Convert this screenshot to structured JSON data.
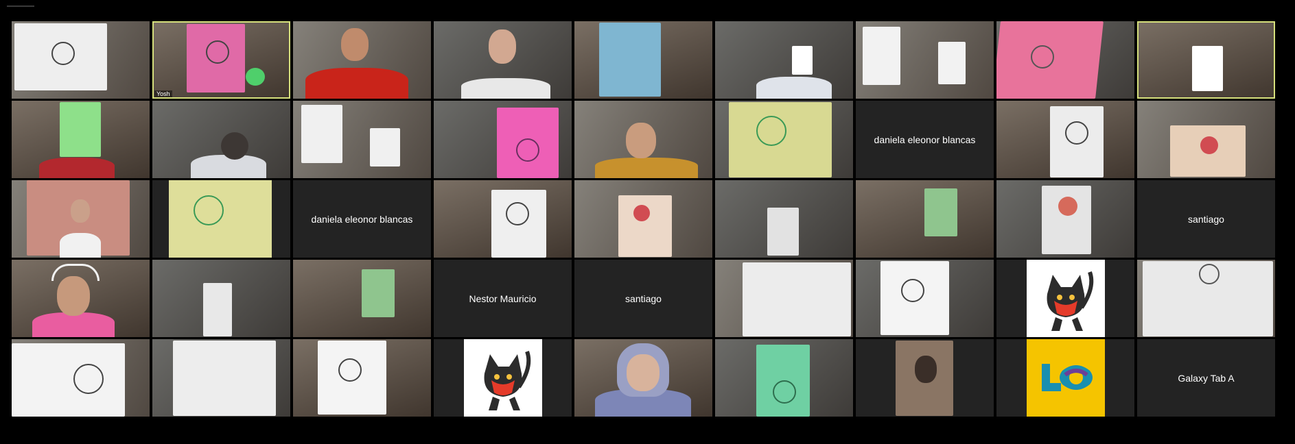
{
  "meeting": {
    "tiles": [
      {
        "label": "",
        "kind": "video"
      },
      {
        "label": "Yosh",
        "kind": "video",
        "active": true
      },
      {
        "label": "",
        "kind": "video"
      },
      {
        "label": "",
        "kind": "video"
      },
      {
        "label": "",
        "kind": "video"
      },
      {
        "label": "",
        "kind": "video"
      },
      {
        "label": "",
        "kind": "video"
      },
      {
        "label": "",
        "kind": "video"
      },
      {
        "label": "",
        "kind": "video",
        "active": true
      },
      {
        "label": "",
        "kind": "video"
      },
      {
        "label": "",
        "kind": "video"
      },
      {
        "label": "",
        "kind": "video"
      },
      {
        "label": "",
        "kind": "video"
      },
      {
        "label": "",
        "kind": "video"
      },
      {
        "label": "",
        "kind": "video"
      },
      {
        "label": "daniela eleonor blancas",
        "kind": "name"
      },
      {
        "label": "",
        "kind": "video"
      },
      {
        "label": "",
        "kind": "video"
      },
      {
        "label": "",
        "kind": "video"
      },
      {
        "label": "",
        "kind": "video"
      },
      {
        "label": "daniela eleonor blancas",
        "kind": "name"
      },
      {
        "label": "",
        "kind": "video"
      },
      {
        "label": "",
        "kind": "video"
      },
      {
        "label": "",
        "kind": "video"
      },
      {
        "label": "",
        "kind": "video"
      },
      {
        "label": "",
        "kind": "video"
      },
      {
        "label": "santiago",
        "kind": "name"
      },
      {
        "label": "",
        "kind": "video"
      },
      {
        "label": "",
        "kind": "video"
      },
      {
        "label": "",
        "kind": "video"
      },
      {
        "label": "Nestor Mauricio",
        "kind": "name"
      },
      {
        "label": "santiago",
        "kind": "name"
      },
      {
        "label": "",
        "kind": "video"
      },
      {
        "label": "",
        "kind": "video"
      },
      {
        "label": "",
        "kind": "avatar-cat"
      },
      {
        "label": "",
        "kind": "video"
      },
      {
        "label": "",
        "kind": "video"
      },
      {
        "label": "",
        "kind": "video"
      },
      {
        "label": "",
        "kind": "video"
      },
      {
        "label": "",
        "kind": "avatar-cat"
      },
      {
        "label": "",
        "kind": "video"
      },
      {
        "label": "",
        "kind": "video"
      },
      {
        "label": "",
        "kind": "video"
      },
      {
        "label": "",
        "kind": "avatar-logo"
      },
      {
        "label": "Galaxy Tab A",
        "kind": "name"
      }
    ],
    "colors": {
      "background": "#000000",
      "tile_bg": "#232323",
      "active_border": "#d6e07c",
      "name_text": "#ffffff"
    },
    "icons": {
      "avatar_cat": "cat-avatar-icon",
      "avatar_logo": "logo-avatar-icon"
    }
  }
}
